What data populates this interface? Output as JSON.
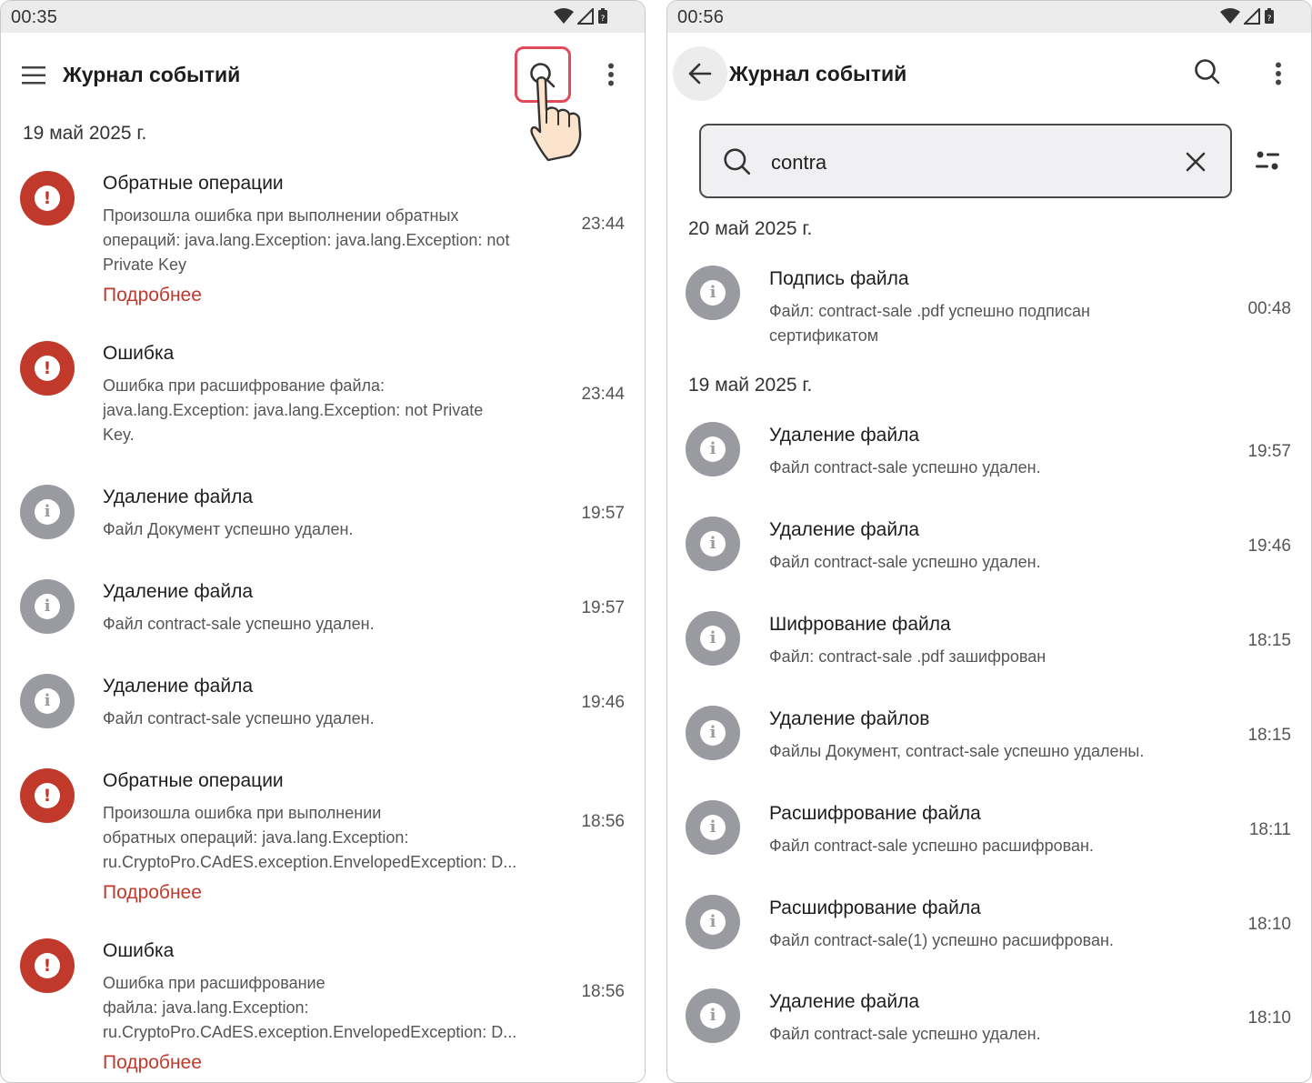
{
  "left": {
    "status_time": "00:35",
    "title": "Журнал событий",
    "date": "19 май 2025 г.",
    "items": [
      {
        "type": "error",
        "title": "Обратные операции",
        "lines": [
          "Произошла ошибка при выполнении обратных",
          "операций: java.lang.Exception: java.lang.Exception: not",
          "Private Key"
        ],
        "link": "Подробнее",
        "time": "23:44"
      },
      {
        "type": "error",
        "title": "Ошибка",
        "lines": [
          "Ошибка при расшифрование файла:",
          "java.lang.Exception: java.lang.Exception: not Private",
          "Key."
        ],
        "time": "23:44"
      },
      {
        "type": "info",
        "title": "Удаление файла",
        "lines": [
          "Файл Документ успешно удален."
        ],
        "time": "19:57"
      },
      {
        "type": "info",
        "title": "Удаление файла",
        "lines": [
          "Файл contract-sale успешно удален."
        ],
        "time": "19:57"
      },
      {
        "type": "info",
        "title": "Удаление файла",
        "lines": [
          "Файл contract-sale успешно удален."
        ],
        "time": "19:46"
      },
      {
        "type": "error",
        "title": "Обратные операции",
        "lines": [
          "Произошла ошибка при выполнении",
          "обратных операций: java.lang.Exception:",
          "ru.CryptoPro.CAdES.exception.EnvelopedException: D..."
        ],
        "link": "Подробнее",
        "time": "18:56"
      },
      {
        "type": "error",
        "title": "Ошибка",
        "lines": [
          "Ошибка при расшифрование",
          "файла: java.lang.Exception:",
          "ru.CryptoPro.CAdES.exception.EnvelopedException: D..."
        ],
        "link": "Подробнее",
        "time": "18:56"
      }
    ]
  },
  "right": {
    "status_time": "00:56",
    "title": "Журнал событий",
    "search_value": "contra",
    "groups": [
      {
        "date": "20 май 2025 г.",
        "items": [
          {
            "type": "info",
            "title": "Подпись файла",
            "lines": [
              "Файл: contract-sale .pdf успешно подписан",
              "сертификатом"
            ],
            "time": "00:48"
          }
        ]
      },
      {
        "date": "19 май 2025 г.",
        "items": [
          {
            "type": "info",
            "title": "Удаление файла",
            "lines": [
              "Файл contract-sale успешно удален."
            ],
            "time": "19:57"
          },
          {
            "type": "info",
            "title": "Удаление файла",
            "lines": [
              "Файл contract-sale успешно удален."
            ],
            "time": "19:46"
          },
          {
            "type": "info",
            "title": "Шифрование файла",
            "lines": [
              "Файл: contract-sale .pdf  зашифрован"
            ],
            "time": "18:15"
          },
          {
            "type": "info",
            "title": "Удаление файлов",
            "lines": [
              "Файлы Документ, contract-sale успешно удалены."
            ],
            "time": "18:15"
          },
          {
            "type": "info",
            "title": "Расшифрование файла",
            "lines": [
              "Файл contract-sale успешно расшифрован."
            ],
            "time": "18:11"
          },
          {
            "type": "info",
            "title": "Расшифрование файла",
            "lines": [
              "Файл contract-sale(1) успешно расшифрован."
            ],
            "time": "18:10"
          },
          {
            "type": "info",
            "title": "Удаление файла",
            "lines": [
              "Файл contract-sale успешно удален."
            ],
            "time": "18:10"
          }
        ]
      }
    ]
  },
  "icons": {
    "error": "exclamation-icon",
    "info": "info-icon",
    "error_color": "#c0392b",
    "info_color": "#9a9ba1",
    "link_color": "#c0392b",
    "highlight_color": "#e04a5a"
  }
}
